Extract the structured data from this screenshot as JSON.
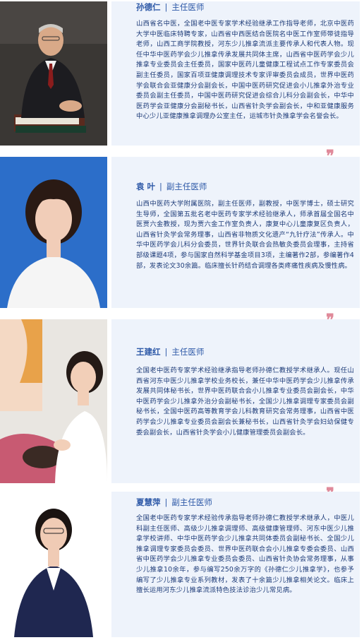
{
  "doctors": [
    {
      "name": "孙德仁",
      "title": "主任医师",
      "bio": "山西省名中医，全国老中医专家学术经验继承工作指导老师，北京中医药大学中医临床特聘专家，山西省中西医结合医院名中医工作室师带徒指导老师，山西工商学院教授，河东少儿推拿流派主要传承人和代表人物。现任中华中医药学会少儿推拿传承发展共同体主席，山西省中医药学会少儿推拿专业委员会主任委员，国家中医药儿童健康工程试点工作专家委员会副主任委员，国家百项亚健康调理技术专家评审委员会成员，世界中医药学会联合会亚健康分会副会长，中国中医药研究促进会小儿推拿外治专业委员会副主任委员，中国中医药研究促进会综合儿科分会副会长，中华中医药学会亚健康分会副秘书长，山西省针灸学会副会长，中和亚健康服务中心少儿亚健康推拿调理办公室主任，运城市针灸推拿学会名誉会长。"
    },
    {
      "name": "袁 叶",
      "title": "副主任医师",
      "bio": "山西中医药大学附属医院，副主任医师，副教授，中医学博士，硕士研究生导师，全国第五批名老中医药专家学术经验继承人，师承首届全国名中医贾六金教授，现为贾六金工作室负责人，康复中心儿童康复区负责人，山西省针灸学会常务理事，山西省非物质文化遗产“九针疗法”传承人。中华中医药学会儿科分会委员，世界针灸联合会热敏灸委员会理事，主持省部级课题4项，参与国家自然科学基金项目3项，主编著作2部，参编著作4部，发表论文30余篇。临床擅长针药结合调理各类疼痛性疾病及慢性病。"
    },
    {
      "name": "王建红",
      "title": "主任医师",
      "bio": "全国老中医药专家学术经验继承指导老师孙德仁教授学术继承人。现任山西省河东中医少儿推拿学校业务校长，兼任中华中医药学会少儿推拿传承发展共同体秘书长，世界中医药联合会小儿推拿专业委员会副会长，中华中医药学会少儿推拿外治分会副秘书长，全国少儿推拿调理专家委员会副秘书长，全国中医药高等教育学会儿科教育研究会常务理事，山西省中医药学会少儿推拿专业委员会副会长兼秘书长，山西省针灸学会妇幼保健专委会副会长，山西省针灸学会小儿健康管理委员会副会长。"
    },
    {
      "name": "夏慧萍",
      "title": "副主任医师",
      "bio": "全国老中医药专家学术经验传承指导老师孙德仁教授学术继承人，中医儿科副主任医师、高级少儿推拿调理师、高级健康管理师、河东中医少儿推拿学校讲师、中华中医药学会少儿推拿共同体委员会副秘书长、全国少儿推拿调理专家委员会委员、世界中医药联合会小儿推拿专委会委员、山西省中医药学会少儿推拿专业委员会委员、山西省针灸协会常务理事，从事少儿推拿10余年，参与编写250余万字的《孙德仁少儿推拿学》，也参予编写了少儿推拿专业系列教材，发表了十余篇少儿推拿相关论文。临床上擅长运用河东少儿推拿流派特色技法诊治少儿常见病。"
    }
  ],
  "separator": "|",
  "quote_mark": "❞"
}
